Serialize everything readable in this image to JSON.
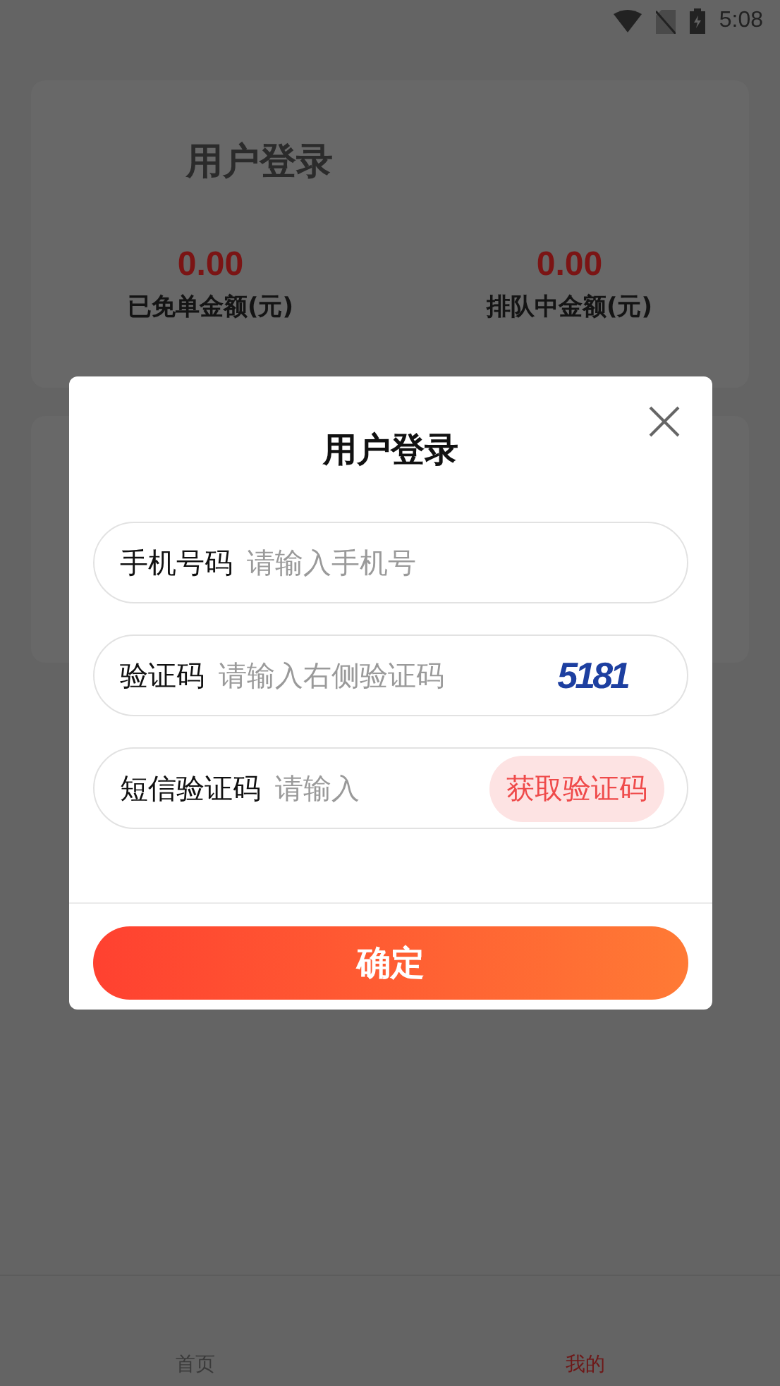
{
  "status_bar": {
    "time": "5:08"
  },
  "summary_card": {
    "title": "用户登录",
    "stats": [
      {
        "value": "0.00",
        "label": "已免单金额(元)"
      },
      {
        "value": "0.00",
        "label": "排队中金额(元)"
      }
    ]
  },
  "login_dialog": {
    "title": "用户登录",
    "fields": [
      {
        "kind": "text",
        "label": "手机号码",
        "placeholder": "请输入手机号"
      },
      {
        "kind": "captcha",
        "label": "验证码",
        "placeholder": "请输入右侧验证码",
        "captcha": "5181"
      },
      {
        "kind": "sms",
        "label": "短信验证码",
        "placeholder": "请输入",
        "action": "获取验证码"
      }
    ],
    "submit": "确定"
  },
  "tab_bar": [
    {
      "label": "首页",
      "selected": false
    },
    {
      "label": "我的",
      "selected": true
    }
  ]
}
